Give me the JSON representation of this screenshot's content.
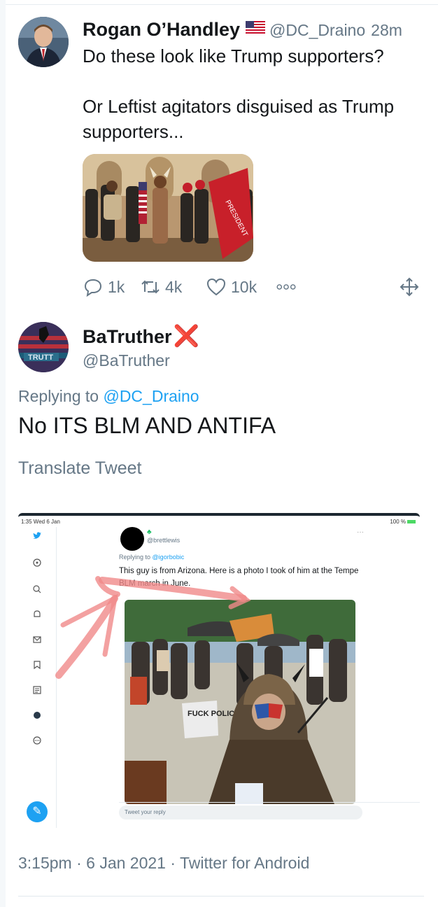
{
  "parent_tweet": {
    "author_name": "Rogan O’Handley",
    "author_handle": "@DC_Draino",
    "time": "28m",
    "text_line1": "Do these look like Trump supporters?",
    "text_line2": "Or Leftist agitators disguised as Trump supporters...",
    "actions": {
      "reply_count": "1k",
      "retweet_count": "4k",
      "like_count": "10k"
    }
  },
  "reply": {
    "author_name": "BaTruther",
    "author_badge": "❌",
    "author_handle": "@BaTruther",
    "replying_prefix": "Replying to",
    "replying_to": "@DC_Draino",
    "text": "No ITS BLM AND ANTIFA",
    "translate_label": "Translate Tweet",
    "meta": "3:15pm · 6 Jan 2021 · Twitter for Android"
  },
  "embedded_screenshot": {
    "status_time": "1:35  Wed 6 Jan",
    "status_battery": "100 %",
    "user": "@brettlewis",
    "replying_prefix": "Replying to",
    "replying_to": "@igorbobic",
    "text": "This guy is from Arizona. Here is a photo I took of him at the Tempe BLM march in June.",
    "sign_text": "FUCK POLICE",
    "reply_placeholder": "Tweet your reply"
  },
  "colors": {
    "link_blue": "#1da1f2",
    "muted_gray": "#657786",
    "badge_red": "#de2a2a"
  }
}
